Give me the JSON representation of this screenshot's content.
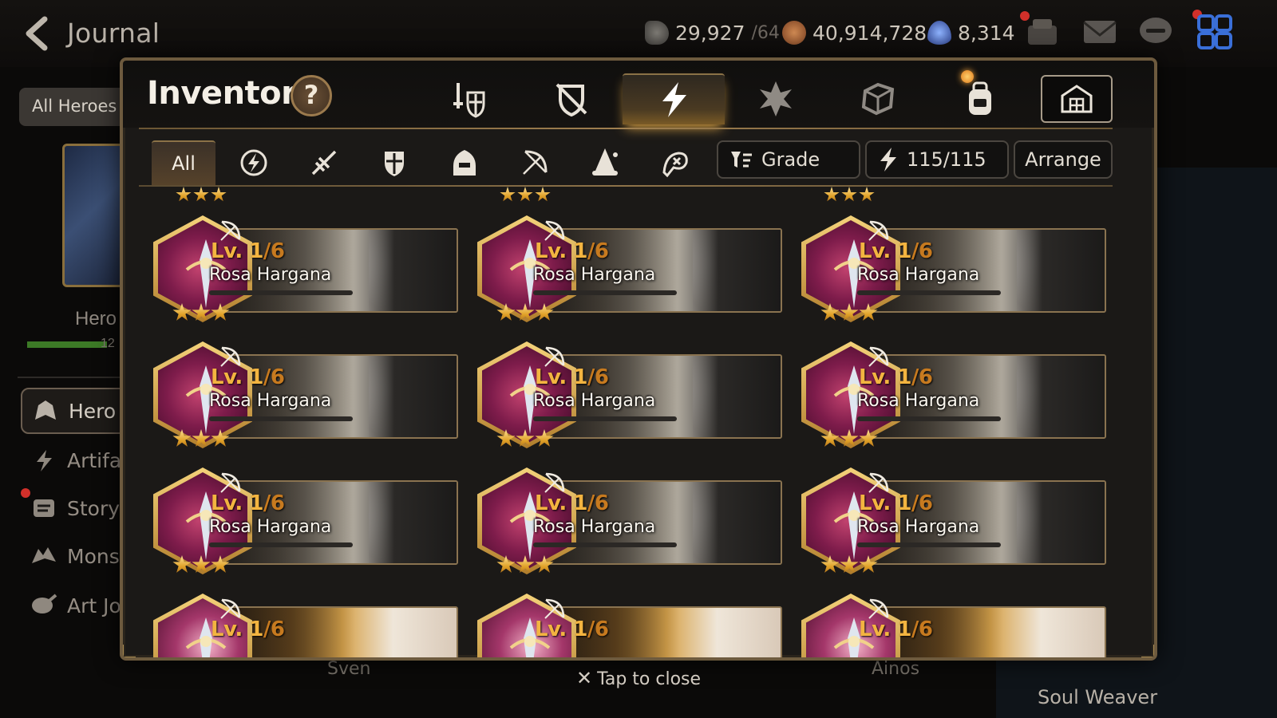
{
  "background": {
    "title": "Journal",
    "currencies": [
      {
        "icon": "stamina-icon",
        "value": "29,927",
        "cap": "/64"
      },
      {
        "icon": "gold-coin-icon",
        "value": "40,914,728",
        "cap": ""
      },
      {
        "icon": "crystal-icon",
        "value": "8,314",
        "cap": ""
      }
    ],
    "top_icons": [
      "guild-icon",
      "mail-icon",
      "chat-icon",
      "menu-grid-icon"
    ],
    "sidebar": {
      "filter_pill": "All Heroes",
      "hero_label": "Hero",
      "hp_number": "12",
      "items": [
        {
          "icon": "hero-icon",
          "label": "Hero"
        },
        {
          "icon": "artifact-icon",
          "label": "Artifa"
        },
        {
          "icon": "story-icon",
          "label": "Story"
        },
        {
          "icon": "monster-icon",
          "label": "Mons"
        },
        {
          "icon": "art-journal-icon",
          "label": "Art Jo"
        }
      ]
    },
    "bottom_labels": [
      "Sven",
      "Ainos"
    ],
    "right_label": "Soul Weaver"
  },
  "inventory": {
    "title": "Inventory",
    "help_label": "?",
    "category_tabs": [
      {
        "icon": "weapon-armor-icon",
        "active": false
      },
      {
        "icon": "shield-crossed-icon",
        "active": false
      },
      {
        "icon": "artifact-bolt-icon",
        "active": true
      },
      {
        "icon": "catalyst-icon",
        "active": false
      },
      {
        "icon": "material-box-icon",
        "active": false
      },
      {
        "icon": "backpack-icon",
        "active": false
      }
    ],
    "store_icon": "storage-house-icon",
    "filter_tabs": [
      {
        "label": "All",
        "icon": "",
        "active": true
      },
      {
        "label": "",
        "icon": "class-all-icon",
        "active": false
      },
      {
        "label": "",
        "icon": "warrior-icon",
        "active": false
      },
      {
        "label": "",
        "icon": "knight-icon",
        "active": false
      },
      {
        "label": "",
        "icon": "thief-icon",
        "active": false
      },
      {
        "label": "",
        "icon": "ranger-icon",
        "active": false
      },
      {
        "label": "",
        "icon": "mage-icon",
        "active": false
      },
      {
        "label": "",
        "icon": "soul-weaver-icon",
        "active": false
      }
    ],
    "grade_button": "Grade",
    "capacity": "115/115",
    "arrange_button": "Arrange",
    "items": [
      {
        "level": "Lv. 1",
        "max": "/6",
        "name": "Rosa Hargana",
        "stars": 3
      },
      {
        "level": "Lv. 1",
        "max": "/6",
        "name": "Rosa Hargana",
        "stars": 3
      },
      {
        "level": "Lv. 1",
        "max": "/6",
        "name": "Rosa Hargana",
        "stars": 3
      },
      {
        "level": "Lv. 1",
        "max": "/6",
        "name": "Rosa Hargana",
        "stars": 3
      },
      {
        "level": "Lv. 1",
        "max": "/6",
        "name": "Rosa Hargana",
        "stars": 3
      },
      {
        "level": "Lv. 1",
        "max": "/6",
        "name": "Rosa Hargana",
        "stars": 3
      },
      {
        "level": "Lv. 1",
        "max": "/6",
        "name": "Rosa Hargana",
        "stars": 3
      },
      {
        "level": "Lv. 1",
        "max": "/6",
        "name": "Rosa Hargana",
        "stars": 3
      },
      {
        "level": "Lv. 1",
        "max": "/6",
        "name": "Rosa Hargana",
        "stars": 3
      }
    ],
    "partial_items": [
      {
        "level": "Lv. 1",
        "max": "/6"
      },
      {
        "level": "Lv. 1",
        "max": "/6"
      },
      {
        "level": "Lv. 1",
        "max": "/6"
      }
    ]
  },
  "close_hint": "Tap to close",
  "colors": {
    "accent_gold": "#e0a127",
    "level_orange": "#f3b440",
    "frame": "#8a7350"
  }
}
